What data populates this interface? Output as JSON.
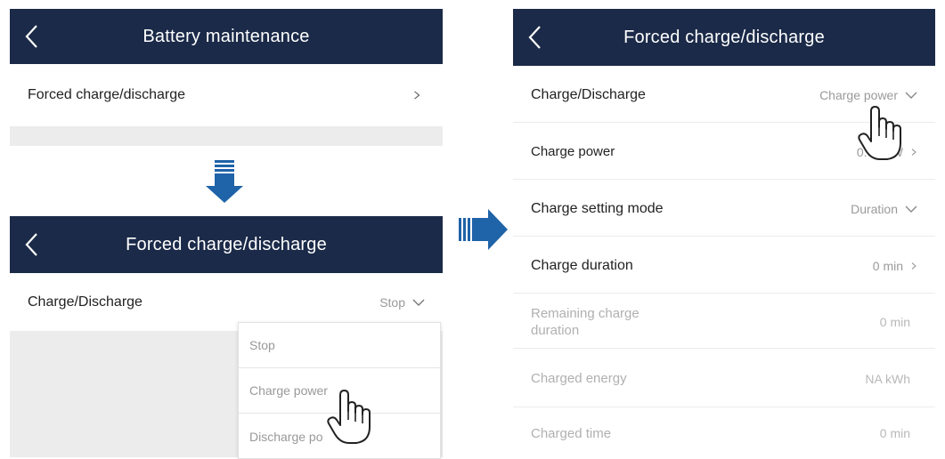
{
  "colors": {
    "header_bg": "#1b2a48",
    "arrow_blue": "#1f63a8",
    "panel_gray": "#ececec"
  },
  "screen1": {
    "title": "Battery maintenance",
    "item_label": "Forced charge/discharge",
    "back_icon": "chevron-left-icon",
    "item_icon": "chevron-right-icon"
  },
  "screen2": {
    "title": "Forced charge/discharge",
    "row_label": "Charge/Discharge",
    "row_value": "Stop",
    "menu": [
      "Stop",
      "Charge power",
      "Discharge po"
    ]
  },
  "screen3": {
    "title": "Forced charge/discharge",
    "rows": [
      {
        "label": "Charge/Discharge",
        "value": "Charge power"
      },
      {
        "label": "Charge power",
        "value": "0.0     W"
      },
      {
        "label": "Charge setting mode",
        "value": "Duration"
      },
      {
        "label": "Charge duration",
        "value": "0 min"
      },
      {
        "label": "Remaining charge duration",
        "value": "0 min"
      },
      {
        "label": "Charged energy",
        "value": "NA kWh"
      },
      {
        "label": "Charged time",
        "value": "0 min"
      }
    ]
  }
}
